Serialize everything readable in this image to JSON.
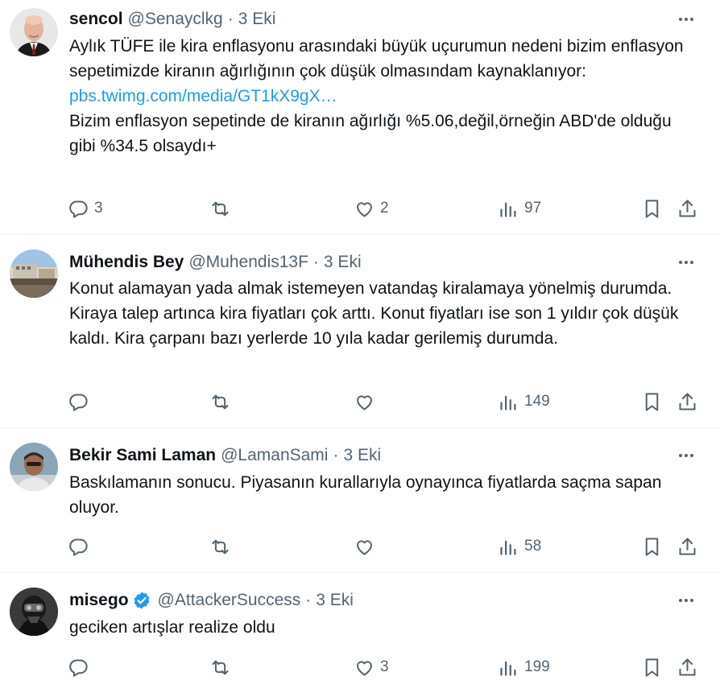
{
  "tweets": [
    {
      "name": "sencol",
      "handle": "@Senayclkg",
      "separator": "·",
      "time": "3 Eki",
      "verified": false,
      "avatar_icon": "avatar-bald-man-suit",
      "text_before_link": "Aylık TÜFE ile kira enflasyonu arasındaki büyük uçurumun nedeni  bizim enflasyon sepetimizde kiranın ağırlığının çok düşük olmasındam kaynaklanıyor:",
      "link": "pbs.twimg.com/media/GT1kX9gX…",
      "text_after_link": "Bizim enflasyon sepetinde de kiranın ağırlığı %5.06,değil,örneğin ABD'de olduğu gibi  %34.5 olsaydı+",
      "replies": "3",
      "retweets": "",
      "likes": "2",
      "views": "97"
    },
    {
      "name": "Mühendis Bey",
      "handle": "@Muhendis13F",
      "separator": "·",
      "time": "3 Eki",
      "verified": false,
      "avatar_icon": "avatar-building-photo",
      "text": "Konut alamayan yada almak istemeyen vatandaş kiralamaya yönelmiş durumda. Kiraya talep artınca kira fiyatları çok arttı. Konut fiyatları ise son 1 yıldır çok düşük kaldı. Kira çarpanı bazı yerlerde 10 yıla kadar gerilemiş durumda.",
      "replies": "",
      "retweets": "",
      "likes": "",
      "views": "149"
    },
    {
      "name": "Bekir Sami Laman",
      "handle": "@LamanSami",
      "separator": "·",
      "time": "3 Eki",
      "verified": false,
      "avatar_icon": "avatar-man-photo",
      "text": "Baskılamanın sonucu. Piyasanın kurallarıyla oynayınca fiyatlarda saçma sapan oluyor.",
      "replies": "",
      "retweets": "",
      "likes": "",
      "views": "58"
    },
    {
      "name": "misego",
      "handle": "@AttackerSuccess",
      "separator": "·",
      "time": "3 Eki",
      "verified": true,
      "avatar_icon": "avatar-dark-helmet",
      "text": "geciken artışlar realize oldu",
      "replies": "",
      "retweets": "",
      "likes": "3",
      "views": "199"
    }
  ],
  "colors": {
    "text": "#0f1419",
    "secondary": "#536471",
    "link": "#1d9bf0",
    "verified": "#1d9bf0",
    "divider": "#eff3f4"
  }
}
